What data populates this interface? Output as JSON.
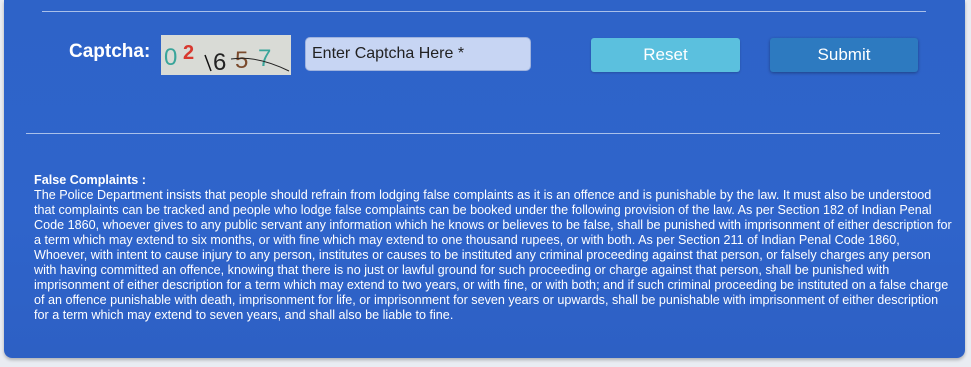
{
  "captcha": {
    "label": "Captcha:",
    "code_image_text": "02657",
    "input_placeholder": "Enter Captcha Here *"
  },
  "actions": {
    "reset_label": "Reset",
    "submit_label": "Submit"
  },
  "notice": {
    "title": "False Complaints :",
    "body": "The Police Department insists that people should refrain from lodging false complaints as it is an offence and is punishable by the law. It must also be understood that complaints can be tracked and people who lodge false complaints can be booked under the following provision of the law. As per Section 182 of Indian Penal Code 1860, whoever gives to any public servant any information which he knows or believes to be false, shall be punished with imprisonment of either description for a term which may extend to six months, or with fine which may extend to one thousand rupees, or with both. As per Section 211 of Indian Penal Code 1860, Whoever, with intent to cause injury to any person, institutes or causes to be instituted any criminal proceeding against that person, or falsely charges any person with having committed an offence, knowing that there is no just or lawful ground for such proceeding or charge against that person, shall be punished with imprisonment of either description for a term which may extend to two years, or with fine, or with both; and if such criminal proceeding be instituted on a false charge of an offence punishable with death, imprisonment for life, or imprisonment for seven years or upwards, shall be punishable with imprisonment of either description for a term which may extend to seven years, and shall also be liable to fine."
  },
  "colors": {
    "panel": "#2e63c8",
    "reset": "#5bc0de",
    "submit": "#2d7ac0",
    "input": "#c7d5f3"
  }
}
